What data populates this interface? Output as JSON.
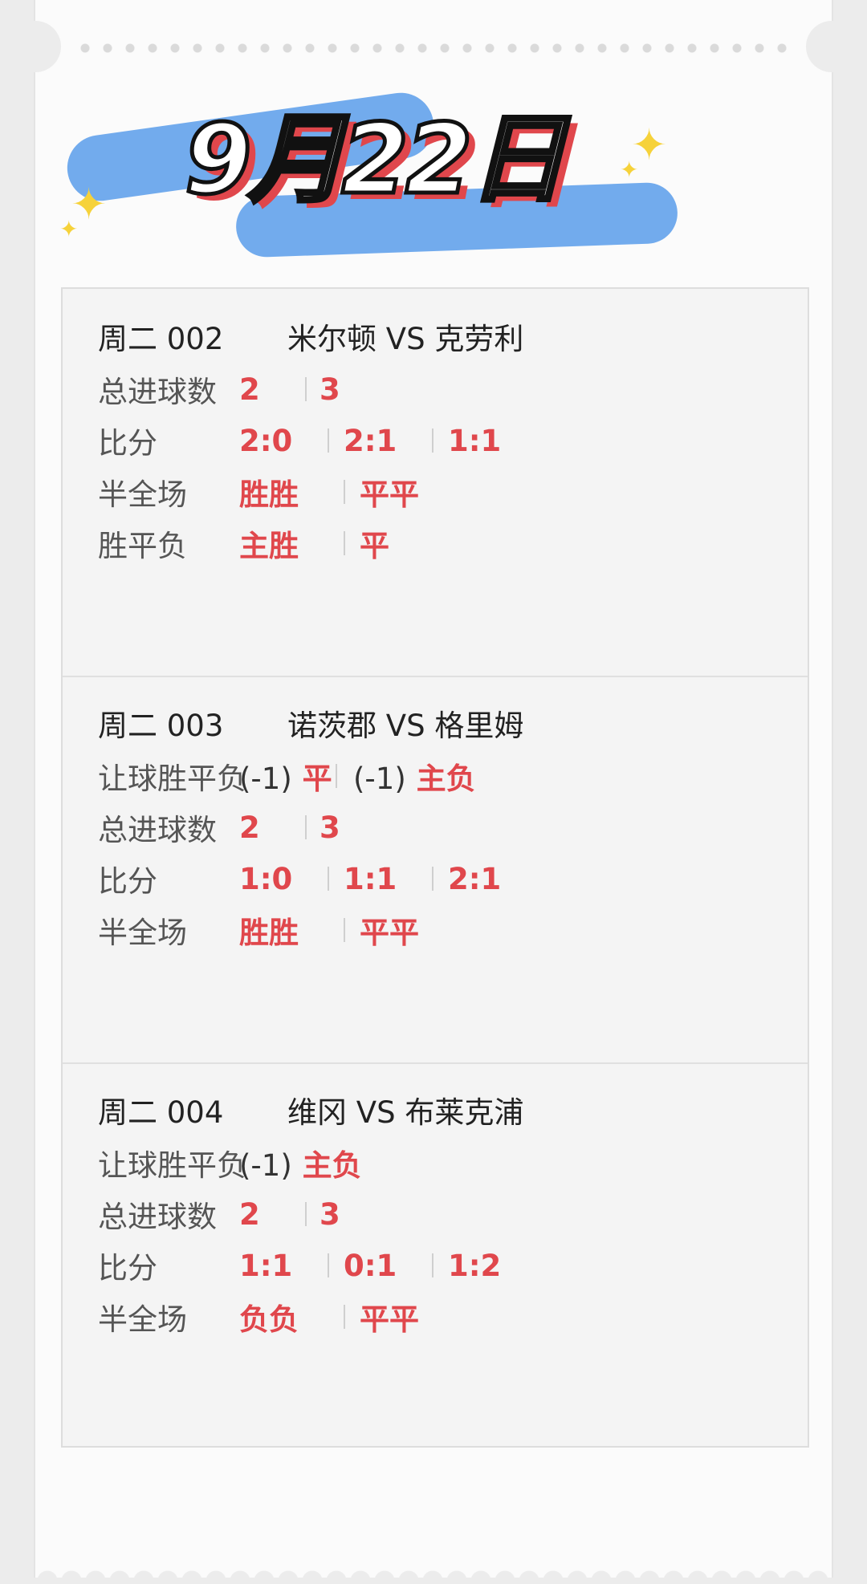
{
  "header": {
    "date": "9月22日"
  },
  "matches": [
    {
      "code": "周二 002",
      "teams": "米尔顿 VS 克劳利",
      "rows": [
        {
          "label": "总进球数",
          "values": [
            "2",
            "3"
          ]
        },
        {
          "label": "比分",
          "values": [
            "2:0",
            "2:1",
            "1:1"
          ]
        },
        {
          "label": "半全场",
          "values": [
            "胜胜",
            "平平"
          ]
        },
        {
          "label": "胜平负",
          "values": [
            "主胜",
            "平"
          ]
        }
      ]
    },
    {
      "code": "周二 003",
      "teams": "诺茨郡 VS 格里姆",
      "rows": [
        {
          "label": "让球胜平负",
          "handicap": "(-1)",
          "values": [
            "平",
            "主负"
          ]
        },
        {
          "label": "总进球数",
          "values": [
            "2",
            "3"
          ]
        },
        {
          "label": "比分",
          "values": [
            "1:0",
            "1:1",
            "2:1"
          ]
        },
        {
          "label": "半全场",
          "values": [
            "胜胜",
            "平平"
          ]
        }
      ]
    },
    {
      "code": "周二 004",
      "teams": "维冈 VS 布莱克浦",
      "rows": [
        {
          "label": "让球胜平负",
          "handicap": "(-1)",
          "values": [
            "主负"
          ]
        },
        {
          "label": "总进球数",
          "values": [
            "2",
            "3"
          ]
        },
        {
          "label": "比分",
          "values": [
            "1:1",
            "0:1",
            "1:2"
          ]
        },
        {
          "label": "半全场",
          "values": [
            "负负",
            "平平"
          ]
        }
      ]
    }
  ],
  "colors": {
    "accent": "#e0474c",
    "brush": "#6aa6ec",
    "sparkle": "#f6d23a"
  }
}
